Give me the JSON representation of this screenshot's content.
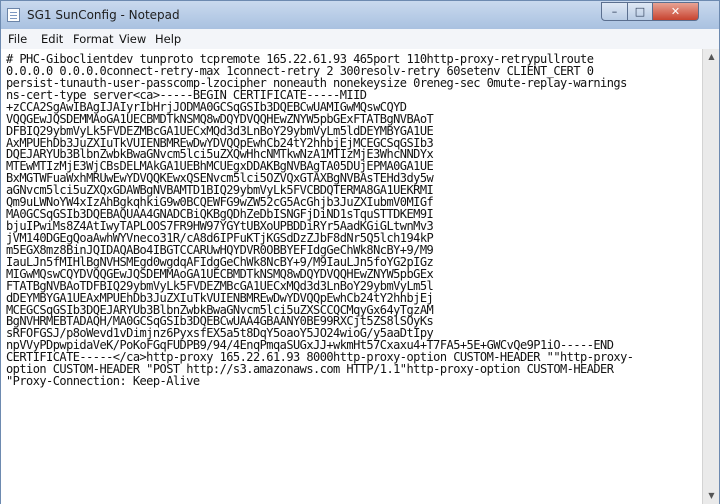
{
  "window": {
    "title": "SG1 SunConfig - Notepad",
    "minimize_label": "–",
    "maximize_label": "□",
    "close_label": "✕"
  },
  "menu": [
    "File",
    "Edit",
    "Format",
    "View",
    "Help"
  ],
  "editor": {
    "lines": [
      "# PHC-Giboclientdev tunproto tcpremote 165.22.61.93 465port 110http-proxy-retrypullroute",
      "0.0.0.0 0.0.0.0connect-retry-max 1connect-retry 2 300resolv-retry 60setenv CLIENT_CERT 0",
      "persist-tunauth-user-passcomp-lzocipher noneauth nonekeysize 0reneg-sec 0mute-replay-warnings",
      "ns-cert-type server<ca>-----BEGIN CERTIFICATE-----MIID",
      "+zCCA2SgAwIBAgIJAIyrIbHrjJODMA0GCSqGSIb3DQEBCwUAMIGwMQswCQYD",
      "VQQGEwJQSDEMMAoGA1UECBMDTkNSMQ8wDQYDVQQHEwZNYW5pbGExFTATBgNVBAoT",
      "DFBIQ29ybmVyLk5FVDEZMBcGA1UECxMQd3d3LnBoY29ybmVyLm5ldDEYMBYGA1UE",
      "AxMPUEhDb3JuZXIuTkVUIENBMREwDwYDVQQpEwhCb24tY2hhbjEjMCEGCSqGSIb3",
      "DQEJARYUb3BlbnZwbkBwaGNvcm5lci5uZXQwHhcNMTkwNzA1MTIzMjE3WhcNNDYx",
      "MTEwMTIzMjE3WjCBsDELMAkGA1UEBhMCUEgxDDAKBgNVBAgTA05DUjEPMA0GA1UE",
      "BxMGTWFuaWxhMRUwEwYDVQQKEwxQSENvcm5lci5OZVQxGTAXBgNVBAsTEHd3dy5w",
      "aGNvcm5lci5uZXQxGDAWBgNVBAMTD1BIQ29ybmVyLk5FVCBDQTERMA8GA1UEKRMI",
      "Qm9uLWNoYW4xIzAhBgkqhkiG9w0BCQEWFG9wZW52cG5AcGhjb3JuZXIubmV0MIGf",
      "MA0GCSqGSIb3DQEBAQUAA4GNADCBiQKBgQDhZeDbISNGFjDiND1sTquSTTDKEM9I",
      "bjuIPwiMs8Z4AtIwyTAPLOOS7FR9HW97YGYtUBXoUPBDDiRYr5AadKGiGLtwnMv3",
      "jVM140DGEgQoaAwhWYVneco31R/cA8d6IPFuKTjKGSdDzZJbF8dNr5Q5lch194kP",
      "m5EGX8mz8BinJQIDAQABo4IBGTCCARUwHQYDVR0OBBYEFIdgGeChWk8NcBY+9/M9",
      "IauLJn5fMIHlBgNVHSMEgd0wgdqAFIdgGeChWk8NcBY+9/M9IauLJn5foYG2pIGz",
      "MIGwMQswCQYDVQQGEwJQSDEMMAoGA1UECBMDTkNSMQ8wDQYDVQQHEwZNYW5pbGEx",
      "FTATBgNVBAoTDFBIQ29ybmVyLk5FVDEZMBcGA1UECxMQd3d3LnBoY29ybmVyLm5l",
      "dDEYMBYGA1UEAxMPUEhDb3JuZXIuTkVUIENBMREwDwYDVQQpEwhCb24tY2hhbjEj",
      "MCEGCSqGSIb3DQEJARYUb3BlbnZwbkBwaGNvcm5lci5uZXSCCQCMqyGx64yTgzAM",
      "BgNVHRMEBTADAQH/MA0GCSqGSIb3DQEBCwUAA4GBAANY0BE99RXCjt5ZS8lSOyKs",
      "sRFOFGSJ/p8oWevd1vDimjnz6PyxsfEX5a5t8DqY5oaoY5JO24wioG/y5aaDtIpy",
      "npVVyPDpwpidaVeK/PoKoFGqFUDPB9/94/4EnqPmqaSUGxJJ+wkmHt57Cxaxu4+T7FA5+5E+GWCvQe9P1iO-----END",
      "CERTIFICATE-----</ca>http-proxy 165.22.61.93 8000http-proxy-option CUSTOM-HEADER \"\"http-proxy-",
      "option CUSTOM-HEADER \"POST http://s3.amazonaws.com HTTP/1.1\"http-proxy-option CUSTOM-HEADER",
      "\"Proxy-Connection: Keep-Alive"
    ]
  },
  "scrollbar": {
    "up_icon": "arrow-up-icon",
    "down_icon": "arrow-down-icon"
  }
}
